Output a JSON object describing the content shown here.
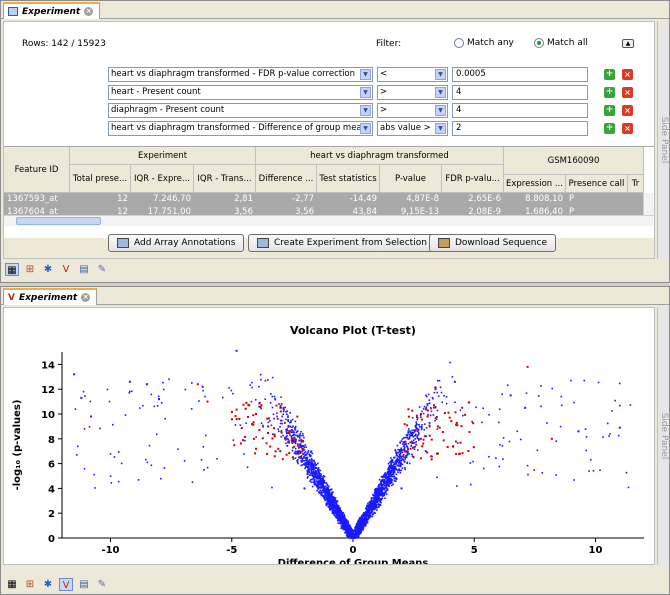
{
  "top_tab": {
    "title": "Experiment"
  },
  "bottom_tab": {
    "title": "Experiment"
  },
  "side_panel_label": "Side Panel",
  "rows_label": "Rows: 142 / 15923",
  "filter": {
    "label": "Filter:",
    "match_any": "Match any",
    "match_all": "Match all",
    "selected": "Match all",
    "rows": [
      {
        "column": "heart vs diaphragm transformed - FDR p-value correction",
        "operator": "<",
        "value": "0.0005"
      },
      {
        "column": "heart - Present count",
        "operator": ">",
        "value": "4"
      },
      {
        "column": "diaphragm - Present count",
        "operator": ">",
        "value": "4"
      },
      {
        "column": "heart vs diaphragm transformed - Difference of group means",
        "operator": "abs value >",
        "value": "2"
      }
    ]
  },
  "table": {
    "group_headers": [
      "Experiment",
      "heart vs diaphragm transformed",
      "GSM160090"
    ],
    "columns": [
      "Feature ID",
      "Total prese...",
      "IQR - Expre...",
      "IQR - Trans...",
      "Difference ...",
      "Test statistics",
      "P-value",
      "FDR p-valu...",
      "Expression ...",
      "Presence call",
      "Tr"
    ],
    "rows": [
      [
        "1367593_at",
        "12",
        "7.246,70",
        "2,81",
        "-2,77",
        "-14,49",
        "4,87E-8",
        "2,65E-6",
        "8.808,10",
        "P"
      ],
      [
        "1367604_at",
        "12",
        "17.751,00",
        "3,56",
        "3,56",
        "43,84",
        "9,15E-13",
        "2,08E-9",
        "1.686,40",
        "P"
      ]
    ]
  },
  "buttons": {
    "add_annotations": "Add Array Annotations",
    "create_experiment": "Create Experiment from Selection",
    "download_sequence": "Download Sequence"
  },
  "colors": {
    "accent_tab": "#f4a94a",
    "blue_points": "#1a1aff",
    "red_points": "#d00000"
  },
  "chart_data": {
    "type": "scatter",
    "title": "Volcano Plot (T-test)",
    "xlabel": "Difference of Group Means",
    "ylabel": "-log₁₀ (p-values)",
    "xlim": [
      -12,
      12
    ],
    "ylim": [
      0,
      15
    ],
    "xticks": [
      -10,
      -5,
      0,
      5,
      10
    ],
    "yticks": [
      0,
      2,
      4,
      6,
      8,
      10,
      12,
      14
    ],
    "series": [
      {
        "color": "#1a1aff",
        "description": "all probe sets (~15923 points forming a V shape)"
      },
      {
        "color": "#d00000",
        "description": "filtered significant probe sets (142 points)"
      }
    ],
    "sample_points_blue": [
      [
        -11.5,
        13.2
      ],
      [
        -11.2,
        11.3
      ],
      [
        -10.8,
        9.8
      ],
      [
        -9.2,
        12.6
      ],
      [
        -8.5,
        12.4
      ],
      [
        -8.0,
        11.2
      ],
      [
        -6.2,
        12.2
      ],
      [
        -4.8,
        15.1
      ],
      [
        -3.0,
        7.0
      ],
      [
        -2.0,
        4.0
      ],
      [
        0.0,
        0.5
      ],
      [
        2.0,
        4.0
      ],
      [
        3.0,
        7.0
      ],
      [
        4.2,
        12.6
      ],
      [
        6.5,
        11.5
      ],
      [
        7.1,
        10.5
      ],
      [
        9.3,
        8.6
      ],
      [
        11.0,
        8.9
      ]
    ],
    "sample_points_red": [
      [
        -6.4,
        12.4
      ],
      [
        -6.0,
        11.0
      ],
      [
        -4.0,
        10.0
      ],
      [
        -3.5,
        9.0
      ],
      [
        -2.8,
        8.0
      ],
      [
        -2.2,
        7.0
      ],
      [
        2.2,
        7.0
      ],
      [
        2.8,
        8.0
      ],
      [
        3.5,
        9.0
      ],
      [
        3.4,
        12.0
      ],
      [
        4.5,
        10.5
      ],
      [
        7.2,
        13.8
      ],
      [
        8.2,
        8.0
      ]
    ]
  },
  "toolbar_icons": [
    "table-icon",
    "filter-icon",
    "scatter-icon",
    "volcano-icon",
    "book-icon",
    "notes-icon"
  ]
}
